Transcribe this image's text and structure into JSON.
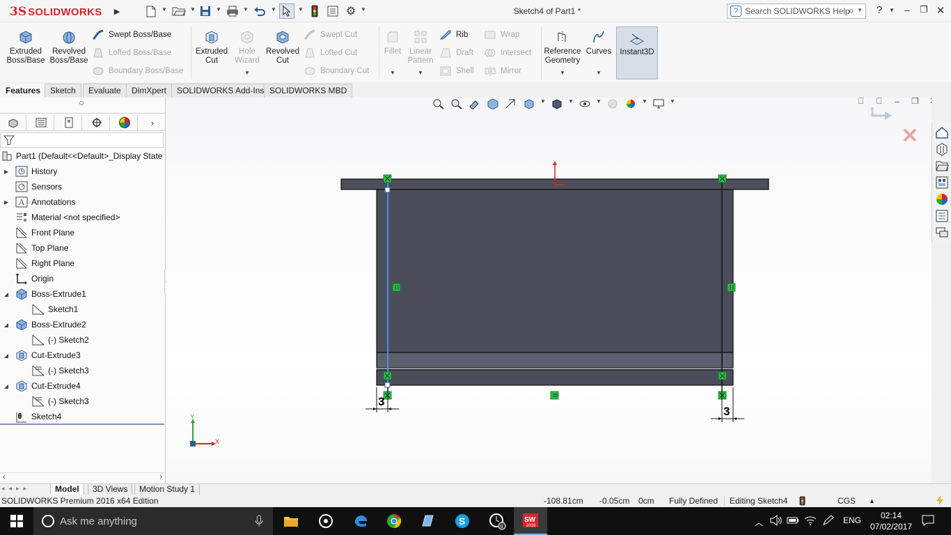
{
  "app": {
    "brand_ds": "3S",
    "brand_name": "SOLIDWORKS",
    "document_title": "Sketch4 of Part1 *",
    "help_search_placeholder": "Search SOLIDWORKS Help"
  },
  "ribbon": {
    "extruded_boss": "Extruded Boss/Base",
    "revolved_boss": "Revolved Boss/Base",
    "swept_boss": "Swept Boss/Base",
    "lofted_boss": "Lofted Boss/Base",
    "boundary_boss": "Boundary Boss/Base",
    "extruded_cut": "Extruded Cut",
    "hole_wizard": "Hole Wizard",
    "revolved_cut": "Revolved Cut",
    "swept_cut": "Swept Cut",
    "lofted_cut": "Lofted Cut",
    "boundary_cut": "Boundary Cut",
    "fillet": "Fillet",
    "linear_pattern": "Linear Pattern",
    "rib": "Rib",
    "draft": "Draft",
    "shell": "Shell",
    "wrap": "Wrap",
    "intersect": "Intersect",
    "mirror": "Mirror",
    "reference_geometry": "Reference Geometry",
    "curves": "Curves",
    "instant3d": "Instant3D"
  },
  "tabs": [
    "Features",
    "Sketch",
    "Evaluate",
    "DimXpert",
    "SOLIDWORKS Add-Ins",
    "SOLIDWORKS MBD"
  ],
  "tree": {
    "root": "Part1  (Default<<Default>_Display State",
    "items": [
      {
        "label": "History"
      },
      {
        "label": "Sensors"
      },
      {
        "label": "Annotations"
      },
      {
        "label": "Material <not specified>"
      },
      {
        "label": "Front Plane"
      },
      {
        "label": "Top Plane"
      },
      {
        "label": "Right Plane"
      },
      {
        "label": "Origin"
      },
      {
        "label": "Boss-Extrude1"
      },
      {
        "label": "Sketch1"
      },
      {
        "label": "Boss-Extrude2"
      },
      {
        "label": "(-) Sketch2"
      },
      {
        "label": "Cut-Extrude3"
      },
      {
        "label": "(-) Sketch3"
      },
      {
        "label": "Cut-Extrude4"
      },
      {
        "label": "(-) Sketch3"
      },
      {
        "label": "Sketch4"
      }
    ]
  },
  "viewport": {
    "dim_left": "3",
    "dim_right": "3",
    "triad_y": "Y",
    "triad_x": "X"
  },
  "bottom_tabs": [
    "Model",
    "3D Views",
    "Motion Study 1"
  ],
  "status": {
    "edition": "SOLIDWORKS Premium 2016 x64 Edition",
    "x": "-108.81cm",
    "y": "-0.05cm",
    "z": "0cm",
    "state": "Fully Defined",
    "editing": "Editing Sketch4",
    "units": "CGS"
  },
  "taskbar": {
    "search_placeholder": "Ask me anything",
    "language": "ENG",
    "time": "02:14",
    "date": "07/02/2017"
  }
}
